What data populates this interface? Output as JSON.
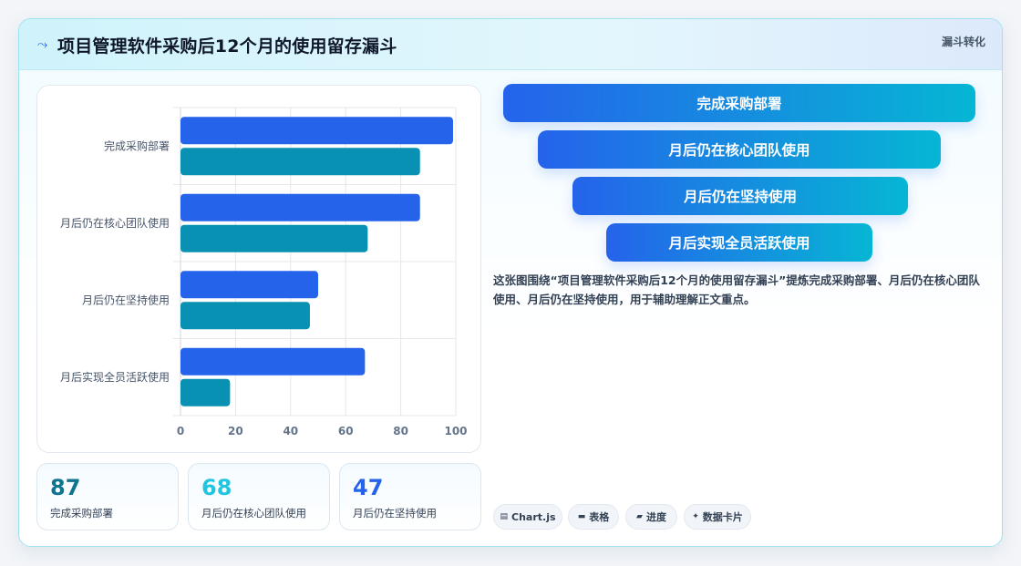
{
  "header": {
    "icon": "sparkline-icon",
    "title": "项目管理软件采购后12个月的使用留存漏斗",
    "badge": "漏斗转化"
  },
  "chart_data": {
    "type": "bar",
    "orientation": "horizontal",
    "categories": [
      "完成采购部署",
      "月后仍在核心团队使用",
      "月后仍在坚持使用",
      "月后实现全员活跃使用"
    ],
    "series": [
      {
        "values": [
          99,
          87,
          50,
          67
        ],
        "color": "#2563eb"
      },
      {
        "values": [
          87,
          68,
          47,
          18
        ],
        "color": "#0891b2"
      }
    ],
    "xlim": [
      0,
      100
    ],
    "xticks": [
      "0",
      "20",
      "40",
      "60",
      "80",
      "100"
    ],
    "grid": true
  },
  "stats": [
    {
      "value": "87",
      "label": "完成采购部署",
      "color": "#0e7490"
    },
    {
      "value": "68",
      "label": "月后仍在核心团队使用",
      "color": "#22c5e0"
    },
    {
      "value": "47",
      "label": "月后仍在坚持使用",
      "color": "#2563eb"
    }
  ],
  "funnel": [
    "完成采购部署",
    "月后仍在核心团队使用",
    "月后仍在坚持使用",
    "月后实现全员活跃使用"
  ],
  "description": "这张图围绕“项目管理软件采购后12个月的使用留存漏斗”提炼完成采购部署、月后仍在核心团队使用、月后仍在坚持使用，用于辅助理解正文重点。",
  "chips": [
    {
      "icon": "chart-icon",
      "label": "Chart.js"
    },
    {
      "icon": "table-icon",
      "label": "表格"
    },
    {
      "icon": "progress-icon",
      "label": "进度"
    },
    {
      "icon": "card-icon",
      "label": "数据卡片"
    }
  ]
}
